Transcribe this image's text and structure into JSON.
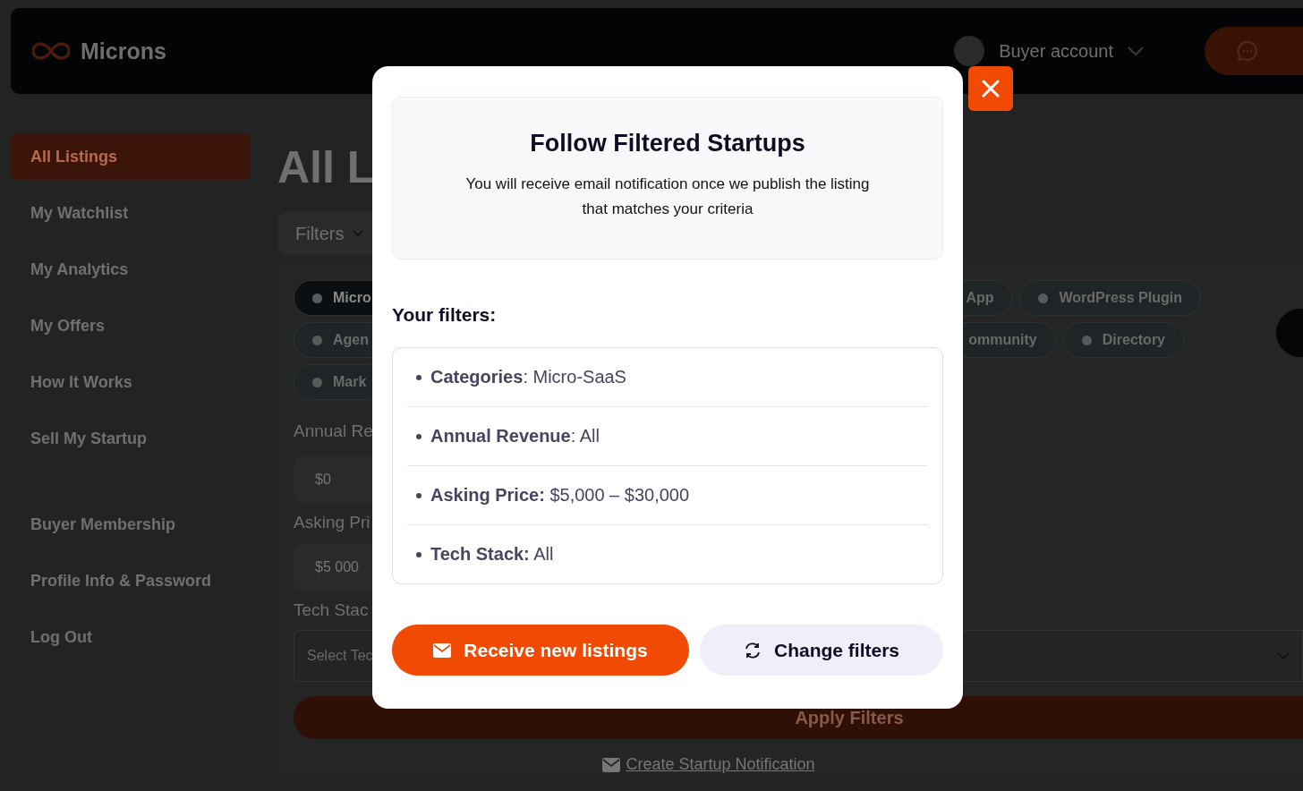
{
  "header": {
    "brand": "Microns",
    "account": "Buyer account"
  },
  "sidebar": {
    "groups": [
      [
        {
          "label": "All Listings",
          "selected": true
        },
        {
          "label": "My Watchlist",
          "selected": false
        },
        {
          "label": "My Analytics",
          "selected": false
        },
        {
          "label": "My Offers",
          "selected": false
        },
        {
          "label": "How It Works",
          "selected": false
        },
        {
          "label": "Sell My Startup",
          "selected": false
        }
      ],
      [
        {
          "label": "Buyer Membership",
          "selected": false
        },
        {
          "label": "Profile Info & Password",
          "selected": false
        },
        {
          "label": "Log Out",
          "selected": false
        }
      ]
    ]
  },
  "main": {
    "heading": "All L",
    "filters_button": "Filters",
    "chip_rows": [
      [
        {
          "label": "Micro",
          "selected": true
        },
        {
          "label": "App",
          "selected": false
        },
        {
          "label": "WordPress Plugin",
          "selected": false
        }
      ],
      [
        {
          "label": "Agen",
          "selected": false
        },
        {
          "label": "ommunity",
          "selected": false
        },
        {
          "label": "Directory",
          "selected": false
        }
      ],
      [
        {
          "label": "Mark",
          "selected": false
        }
      ]
    ],
    "annual_revenue": {
      "label": "Annual Re",
      "value": "$0"
    },
    "asking_price": {
      "label": "Asking Pri",
      "value": "$5 000"
    },
    "tech_stack": {
      "label": "Tech Stac",
      "placeholder": "Select Tec"
    },
    "apply_button": "Apply Filters",
    "notification_link": "Create Startup Notification"
  },
  "modal": {
    "title": "Follow Filtered Startups",
    "description": "You will receive email notification once we publish the listing that matches your criteria",
    "filters_heading": "Your filters:",
    "filters": [
      "**Categories**: Micro-SaaS",
      "**Annual Revenue**: All",
      "**Asking Price:** $5,000 – $30,000",
      "**Tech Stack:** All"
    ],
    "primary_button": "Receive new listings",
    "secondary_button": "Change filters"
  }
}
